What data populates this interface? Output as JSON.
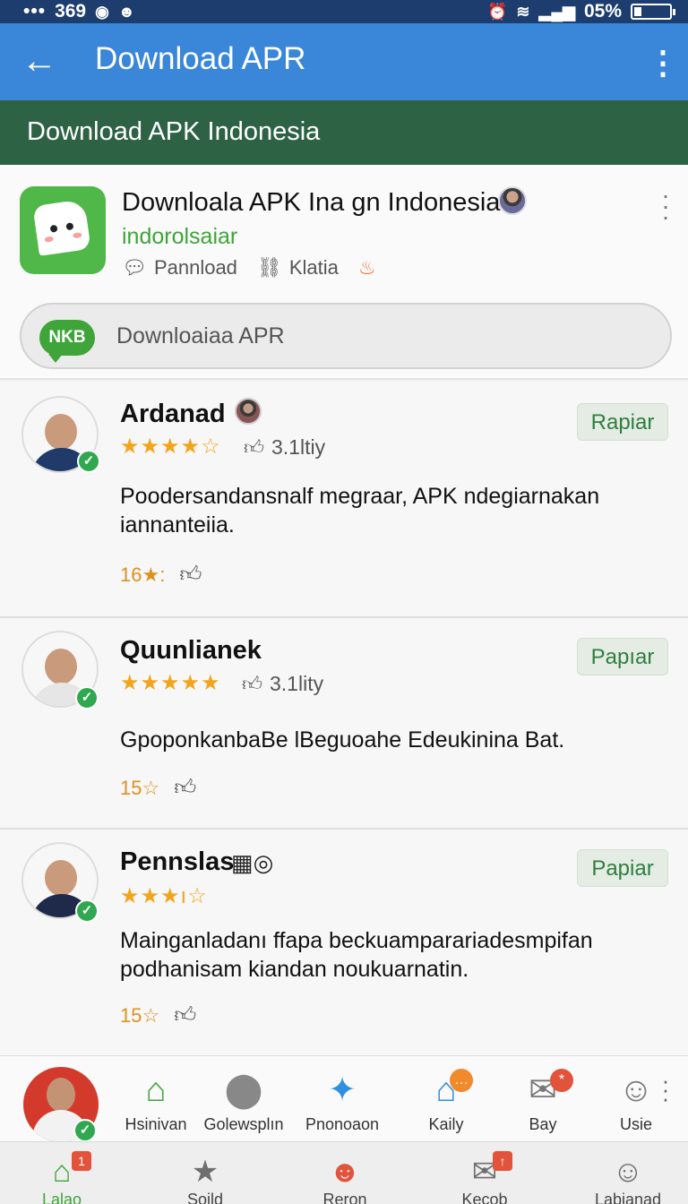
{
  "status_bar": {
    "dots": "•••",
    "count": "369",
    "battery": "05%"
  },
  "app_bar": {
    "back_label": "←",
    "title": "Download APR",
    "menu_label": "⋮"
  },
  "sub_bar": {
    "title": "Download APK Indonesia"
  },
  "app_card": {
    "name": "Downloala APK Ina gn Indonesia",
    "developer": "indorolsaiar",
    "meta_1": "Pannload",
    "meta_2": "Klatia",
    "search": {
      "badge": "NKB",
      "text": "Downloaiaa APR"
    }
  },
  "reviews": [
    {
      "name": "Ardanad",
      "stars": "★★★★",
      "stars_empty": "☆",
      "likes": "3.1ltiy",
      "reply": "Rapiar",
      "text": "Poodersandansnalf megraar, APK ndegiarnakan iannanteiia.",
      "foot": "16★:"
    },
    {
      "name": "Quunlianek",
      "stars": "★★★★★",
      "stars_empty": "",
      "likes": "3.1lity",
      "reply": "Papıar",
      "text": "GpoponkanbaBe lBeguoahe Edeukinina Bat.",
      "foot": "15☆"
    },
    {
      "name": "Pennslas",
      "stars": "★★★",
      "stars_empty": "ı☆",
      "likes": "",
      "reply": "Papiar",
      "text": "Mainganladanı ffapa beckuamparariadesmpifan podhanisam kiandan noukuarnatin.",
      "foot": "15☆"
    }
  ],
  "shortcuts": [
    {
      "label": "Hsinivan",
      "icon": "house-icon"
    },
    {
      "label": "Golewsplın",
      "icon": "location-pin-icon"
    },
    {
      "label": "Pnonoaon",
      "icon": "gift-icon"
    },
    {
      "label": "Kaily",
      "icon": "chat-house-icon"
    },
    {
      "label": "Bay",
      "icon": "mail-icon"
    },
    {
      "label": "Usie",
      "icon": "user-icon"
    }
  ],
  "bottom_nav": [
    {
      "label": "Lalao",
      "icon": "home-icon",
      "badge": "1"
    },
    {
      "label": "Soild",
      "icon": "star-icon"
    },
    {
      "label": "Reron",
      "icon": "face-icon"
    },
    {
      "label": "Kecob",
      "icon": "mail-check-icon",
      "badge": "↑"
    },
    {
      "label": "Labianad",
      "icon": "profile-icon"
    }
  ],
  "colors": {
    "app_bar": "#3a86d8",
    "sub_bar": "#2e6245",
    "accent": "#3fa43a",
    "star": "#f2a51c"
  }
}
